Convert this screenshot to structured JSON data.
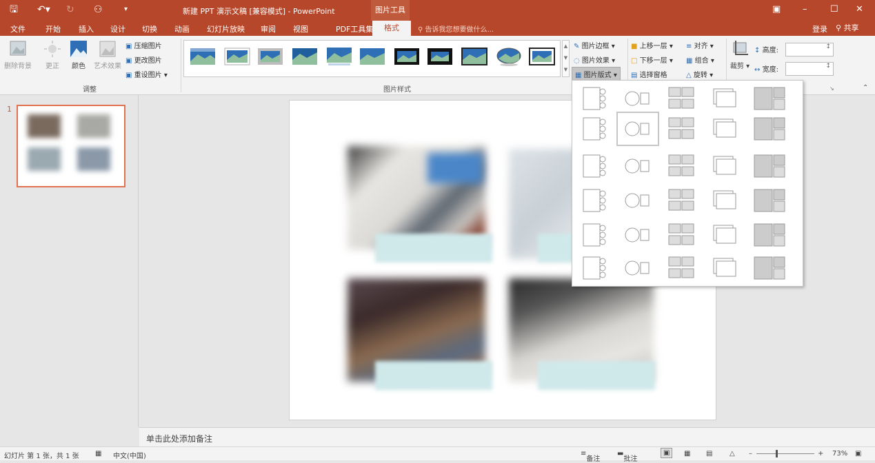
{
  "titlebar": {
    "title": "新建 PPT 演示文稿 [兼容模式] - PowerPoint",
    "context_tab": "图片工具",
    "window_controls": [
      "restore-ribbon",
      "minimize",
      "maximize",
      "close"
    ]
  },
  "tabs": [
    "文件",
    "开始",
    "插入",
    "设计",
    "切换",
    "动画",
    "幻灯片放映",
    "审阅",
    "视图",
    "PDF工具集",
    "格式"
  ],
  "active_tab": "格式",
  "tell_me": "告诉我您想要做什么...",
  "login": "登录",
  "share": "共享",
  "ribbon": {
    "adjust": {
      "remove_bg": "删除背景",
      "corrections": "更正",
      "color": "颜色",
      "artistic": "艺术效果",
      "compress": "压缩图片",
      "change": "更改图片",
      "reset": "重设图片",
      "group_label": "调整"
    },
    "styles": {
      "group_label": "图片样式",
      "border": "图片边框",
      "effects": "图片效果",
      "layout": "图片版式"
    },
    "arrange": {
      "bring_forward": "上移一层",
      "send_backward": "下移一层",
      "selection_pane": "选择窗格",
      "align": "对齐",
      "group": "组合",
      "rotate": "旋转"
    },
    "size": {
      "crop": "裁剪",
      "height_label": "高度:",
      "width_label": "宽度:",
      "height_value": "",
      "width_value": ""
    }
  },
  "slides_pane": {
    "slide_number": "1"
  },
  "notes_placeholder": "单击此处添加备注",
  "statusbar": {
    "slide_info": "幻灯片 第 1 张，共 1 张",
    "language": "中文(中国)",
    "notes": "备注",
    "comments": "批注",
    "zoom": "73%"
  },
  "colors": {
    "brand": "#b7472a",
    "accent_light": "#e0704f",
    "caption": "#cfe8ea"
  }
}
